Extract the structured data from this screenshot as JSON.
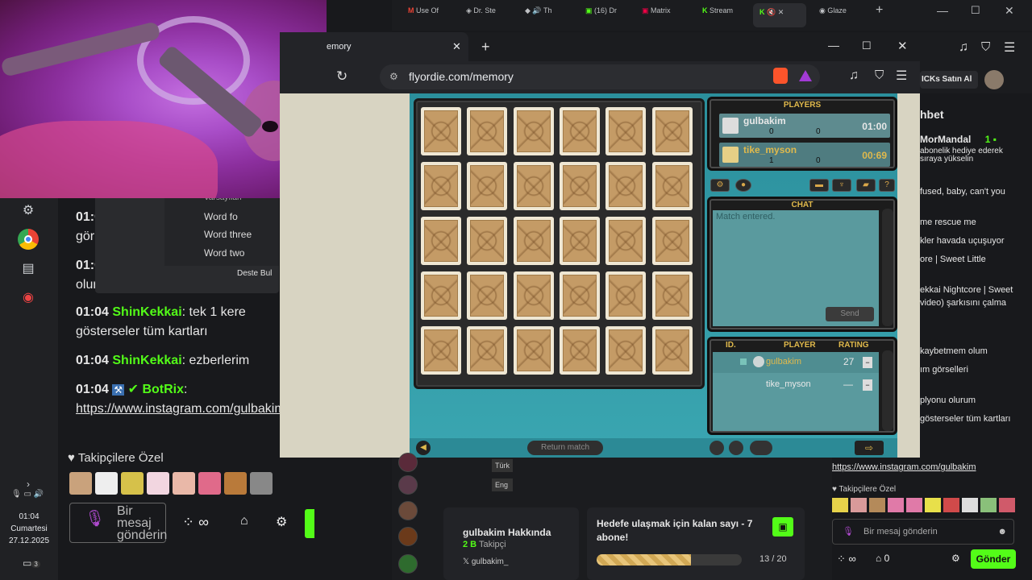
{
  "outer_tabs": [
    "Use Of",
    "Dr. Ste",
    "Th",
    "(16) Dr",
    "Matrix",
    "Stream",
    "Glaze"
  ],
  "browser": {
    "tab_title": "emory",
    "url": "flyordie.com/memory"
  },
  "taskbar": {
    "time": "01:04",
    "day": "Cumartesi",
    "date": "27.12.2025",
    "notification_count": "3"
  },
  "context_menu": {
    "items": [
      "Varsayılan",
      "Word fo",
      "Word three",
      "Word two"
    ],
    "button": "Deste Bul"
  },
  "left_chat": {
    "messages": [
      {
        "time": "01:0",
        "text": "gör"
      },
      {
        "time": "01:0",
        "text": "olur"
      },
      {
        "time": "01:04",
        "user": "ShinKekkai",
        "text": "tek 1 kere gösterseler tüm kartları"
      },
      {
        "time": "01:04",
        "user": "ShinKekkai",
        "text": "ezberlerim"
      },
      {
        "time": "01:04",
        "user": "BotRix",
        "text": "https://www.instagram.com/gulbakim"
      }
    ],
    "followers_title": "Takipçilere Özel",
    "input_placeholder": "Bir mesaj gönderin"
  },
  "game": {
    "players_head": "PLAYERS",
    "players": [
      {
        "name": "gulbakim",
        "a": "0",
        "b": "0",
        "time": "01:00",
        "color": "#e8e8e8"
      },
      {
        "name": "tike_myson",
        "a": "1",
        "b": "0",
        "time": "00:69",
        "color": "#e0b94c"
      }
    ],
    "chat_head": "CHAT",
    "chat_text": "Match entered.",
    "send": "Send",
    "table_heads": [
      "ID.",
      "PLAYER",
      "RATING"
    ],
    "table_rows": [
      {
        "player": "gulbakim",
        "rating": "27"
      },
      {
        "player": "tike_myson",
        "rating": "—"
      }
    ],
    "return_match": "Return match",
    "rows": 5,
    "cols": 6
  },
  "right_chat": {
    "header_btn": "ICKs Satın Al",
    "title": "hbet",
    "user": "MorMandal",
    "lines": [
      "abonelik hediye ederek",
      "sıraya yükselin",
      "fused, baby, can't you",
      "me rescue me",
      "kler havada uçuşuyor",
      "ore | Sweet Little",
      "ekkai Nightcore | Sweet",
      "video) şarkısını çalma",
      "kaybetmem olum",
      "ım görselleri",
      "plyonu olurum",
      "gösterseler tüm kartları"
    ],
    "link": "https://www.instagram.com/gulbakim",
    "followers_title": "Takipçilere Özel",
    "input_placeholder": "Bir mesaj gönderin",
    "send": "Gönder",
    "count": "0"
  },
  "lower": {
    "langs": [
      "Türk",
      "Eng"
    ],
    "about_title": "gulbakim Hakkında",
    "followers": "2 B",
    "followers_label": "Takipçi",
    "x_handle": "gulbakim_",
    "goal_title": "Hedefe ulaşmak için kalan sayı - 7 abone!",
    "goal_progress": "13 / 20",
    "goal_fraction": 0.65
  }
}
